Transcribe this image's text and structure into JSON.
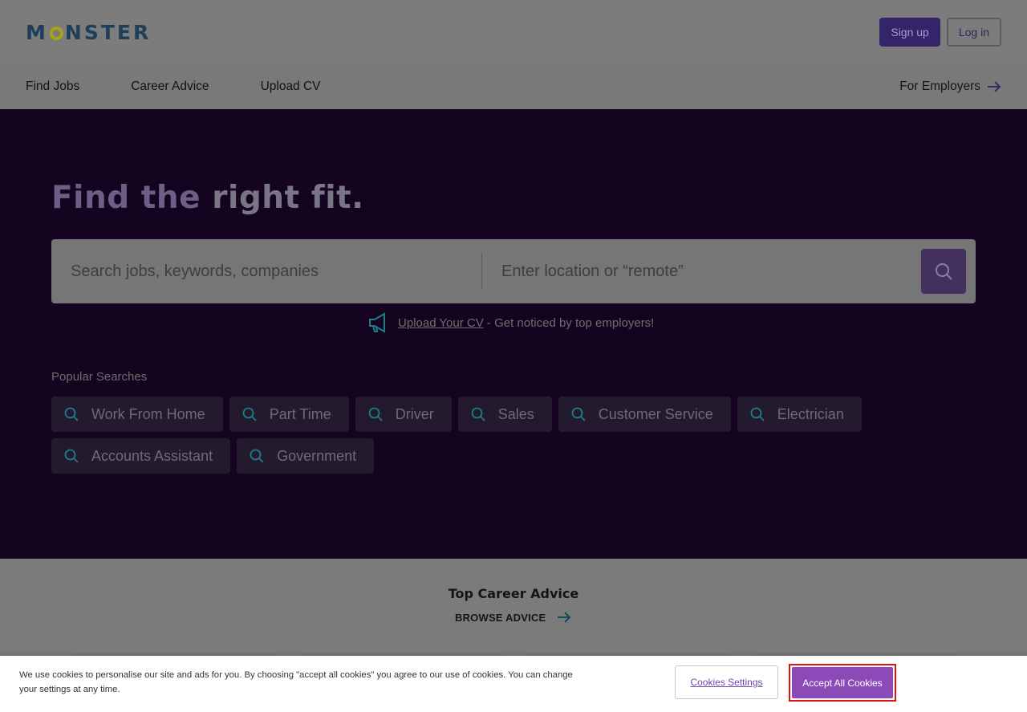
{
  "header": {
    "logo_text": "MONSTER",
    "signup_label": "Sign up",
    "login_label": "Log in"
  },
  "nav": {
    "items": [
      {
        "label": "Find Jobs"
      },
      {
        "label": "Career Advice"
      },
      {
        "label": "Upload CV"
      }
    ],
    "employers_label": "For Employers"
  },
  "hero": {
    "title_part1": "Find the",
    "title_part2": "right fit.",
    "search": {
      "keywords_placeholder": "Search jobs, keywords, companies",
      "location_placeholder": "Enter location or “remote”"
    },
    "upload": {
      "link_text": "Upload Your CV",
      "suffix": " - Get noticed by top employers!"
    },
    "popular_label": "Popular Searches",
    "popular_searches": [
      "Work From Home",
      "Part Time",
      "Driver",
      "Sales",
      "Customer Service",
      "Electrician",
      "Accounts Assistant",
      "Government"
    ]
  },
  "advice": {
    "title": "Top Career Advice",
    "browse_label": "BROWSE ADVICE"
  },
  "cookie_banner": {
    "text": "We use cookies to personalise our site and ads for you. By choosing \"accept all cookies\" you agree to our use of cookies. You can change your settings at any time.",
    "settings_label": "Cookies Settings",
    "accept_label": "Accept All Cookies"
  },
  "colors": {
    "hero_bg": "#14041f",
    "brand_purple": "#6e46ae",
    "accept_button": "#8b4ab8",
    "highlight_border": "#e01313",
    "chip_icon_teal": "#1f7c8c"
  }
}
